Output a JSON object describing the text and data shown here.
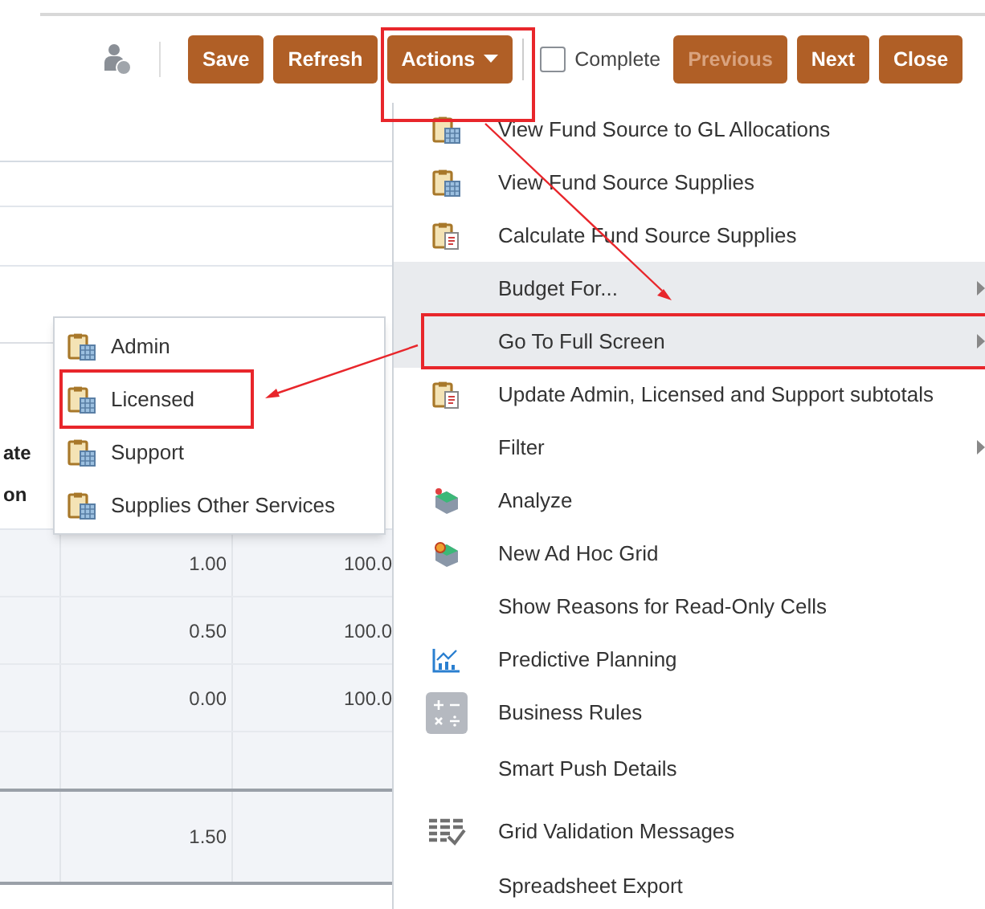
{
  "toolbar": {
    "buttons": [
      {
        "kind": "button",
        "label": "Save",
        "disabled": false
      },
      {
        "kind": "button",
        "label": "Refresh",
        "disabled": false
      },
      {
        "kind": "dropdown",
        "label": "Actions",
        "disabled": false
      },
      {
        "kind": "checkbox",
        "label": "Complete",
        "checked": false
      },
      {
        "kind": "button",
        "label": "Previous",
        "disabled": true
      },
      {
        "kind": "button",
        "label": "Next",
        "disabled": false
      },
      {
        "kind": "button",
        "label": "Close",
        "disabled": false
      }
    ]
  },
  "grid": {
    "header_fragments": [
      "ate",
      "on"
    ],
    "rows": [
      {
        "kind": "data",
        "cells": [
          "1.00",
          "100.0"
        ]
      },
      {
        "kind": "data",
        "cells": [
          "0.50",
          "100.0"
        ]
      },
      {
        "kind": "data",
        "cells": [
          "0.00",
          "100.0"
        ]
      },
      {
        "kind": "empty",
        "cells": []
      },
      {
        "kind": "total",
        "cells": [
          "1.50"
        ]
      }
    ]
  },
  "actions_menu": {
    "items": [
      {
        "label": "View Fund Source to GL Allocations",
        "kind": "form",
        "highlighted": false,
        "has_submenu": false
      },
      {
        "label": "View Fund Source Supplies",
        "kind": "form",
        "highlighted": false,
        "has_submenu": false
      },
      {
        "label": "Calculate Fund Source Supplies",
        "kind": "rule",
        "highlighted": false,
        "has_submenu": false
      },
      {
        "label": "Budget For...",
        "kind": "plain",
        "highlighted": true,
        "has_submenu": true
      },
      {
        "label": "Go To Full Screen",
        "kind": "plain",
        "highlighted": true,
        "has_submenu": true
      },
      {
        "label": "Update Admin, Licensed and Support subtotals",
        "kind": "rule",
        "highlighted": false,
        "has_submenu": false
      },
      {
        "label": "Filter",
        "kind": "plain",
        "highlighted": false,
        "has_submenu": true
      },
      {
        "label": "Analyze",
        "kind": "analyze",
        "highlighted": false,
        "has_submenu": false
      },
      {
        "label": "New Ad Hoc Grid",
        "kind": "adhoc",
        "highlighted": false,
        "has_submenu": false
      },
      {
        "label": "Show Reasons for Read-Only Cells",
        "kind": "plain",
        "highlighted": false,
        "has_submenu": false
      },
      {
        "label": "Predictive Planning",
        "kind": "predictive",
        "highlighted": false,
        "has_submenu": false
      },
      {
        "label": "Business Rules",
        "kind": "rules",
        "highlighted": false,
        "has_submenu": false
      },
      {
        "label": "Smart Push Details",
        "kind": "plain",
        "highlighted": false,
        "has_submenu": false
      },
      {
        "label": "Grid Validation Messages",
        "kind": "validation",
        "highlighted": false,
        "has_submenu": false
      },
      {
        "label": "Spreadsheet Export",
        "kind": "plain",
        "highlighted": false,
        "has_submenu": false
      }
    ]
  },
  "submenu": {
    "items": [
      {
        "label": "Admin"
      },
      {
        "label": "Licensed"
      },
      {
        "label": "Support"
      },
      {
        "label": "Supplies Other Services"
      }
    ]
  }
}
